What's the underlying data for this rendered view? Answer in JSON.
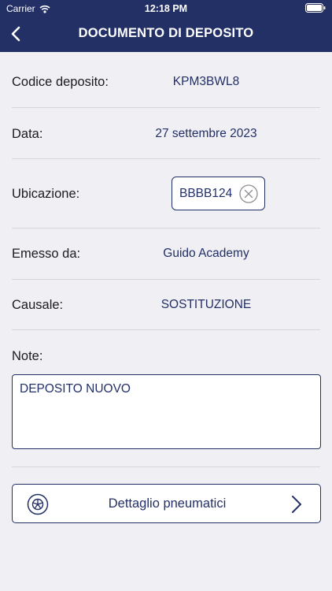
{
  "status_bar": {
    "carrier": "Carrier",
    "time": "12:18 PM"
  },
  "header": {
    "title": "DOCUMENTO DI DEPOSITO",
    "back_icon": "chevron-left-icon"
  },
  "fields": {
    "deposit_code": {
      "label": "Codice deposito:",
      "value": "KPM3BWL8"
    },
    "date": {
      "label": "Data:",
      "value": "27 settembre 2023"
    },
    "location": {
      "label": "Ubicazione:",
      "value": "BBBB124",
      "clear_icon": "clear-circle-icon"
    },
    "issued_by": {
      "label": "Emesso da:",
      "value": "Guido Academy"
    },
    "reason": {
      "label": "Causale:",
      "value": "SOSTITUZIONE"
    },
    "notes": {
      "label": "Note:",
      "value": "DEPOSITO NUOVO"
    }
  },
  "details_button": {
    "label": "Dettaglio pneumatici",
    "icon": "tire-icon",
    "chevron_icon": "chevron-right-icon"
  },
  "colors": {
    "brand": "#233066",
    "background": "#EFEFF4",
    "divider": "#D6D6DA"
  }
}
